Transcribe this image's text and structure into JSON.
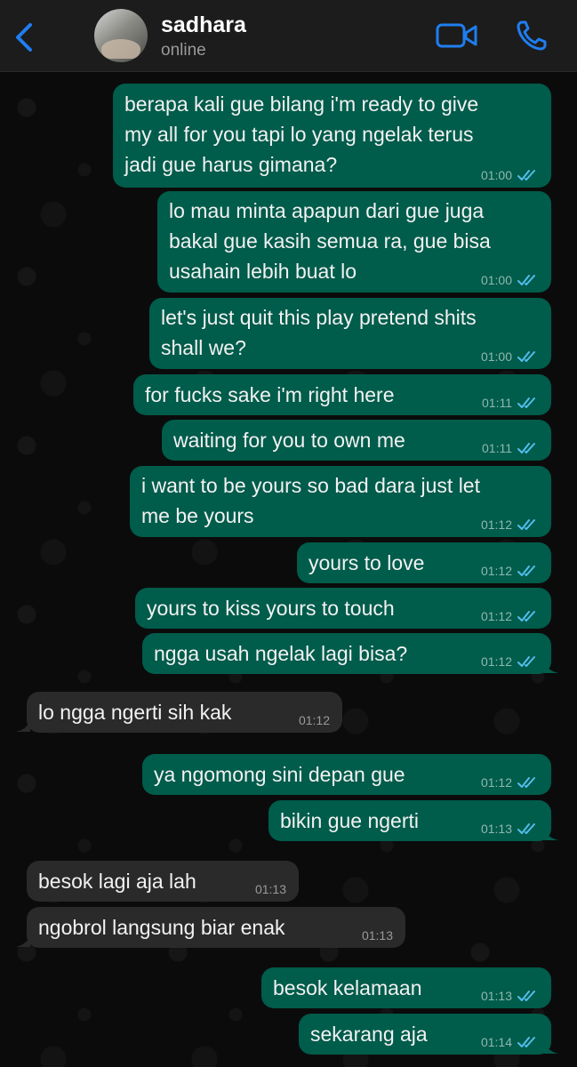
{
  "header": {
    "back_icon": "chevron-left-icon",
    "contact_name": "sadhara",
    "status": "online",
    "video_icon": "video-camera-icon",
    "call_icon": "phone-icon",
    "accent_color": "#1f7ef0"
  },
  "colors": {
    "outgoing_bubble": "#005c4b",
    "incoming_bubble": "#2a2a2a",
    "read_ticks": "#53bdeb",
    "background": "#0b0b0b"
  },
  "messages": [
    {
      "direction": "out",
      "text": "berapa kali gue bilang i'm ready to give\nmy all for you tapi lo yang ngelak terus\njadi gue harus gimana?",
      "time": "01:00",
      "status": "read"
    },
    {
      "direction": "out",
      "text": "lo mau minta apapun dari gue juga\nbakal gue kasih semua ra, gue bisa\nusahain lebih buat lo",
      "time": "01:00",
      "status": "read"
    },
    {
      "direction": "out",
      "text": "let's just quit this play pretend shits\nshall we?",
      "time": "01:00",
      "status": "read"
    },
    {
      "direction": "out",
      "text": "for fucks sake i'm right here",
      "time": "01:11",
      "status": "read"
    },
    {
      "direction": "out",
      "text": "waiting for you to own me",
      "time": "01:11",
      "status": "read"
    },
    {
      "direction": "out",
      "text": "i want to be yours so bad dara just let\nme be yours",
      "time": "01:12",
      "status": "read"
    },
    {
      "direction": "out",
      "text": "yours to love",
      "time": "01:12",
      "status": "read"
    },
    {
      "direction": "out",
      "text": "yours to kiss yours to touch",
      "time": "01:12",
      "status": "read"
    },
    {
      "direction": "out",
      "text": "ngga usah ngelak lagi bisa?",
      "time": "01:12",
      "status": "read"
    },
    {
      "direction": "in",
      "text": "lo ngga ngerti sih kak",
      "time": "01:12"
    },
    {
      "direction": "out",
      "text": "ya ngomong sini depan gue",
      "time": "01:12",
      "status": "read"
    },
    {
      "direction": "out",
      "text": "bikin gue ngerti",
      "time": "01:13",
      "status": "read"
    },
    {
      "direction": "in",
      "text": "besok lagi aja lah",
      "time": "01:13"
    },
    {
      "direction": "in",
      "text": "ngobrol langsung biar enak",
      "time": "01:13"
    },
    {
      "direction": "out",
      "text": "besok kelamaan",
      "time": "01:13",
      "status": "read"
    },
    {
      "direction": "out",
      "text": "sekarang aja",
      "time": "01:14",
      "status": "read"
    }
  ]
}
